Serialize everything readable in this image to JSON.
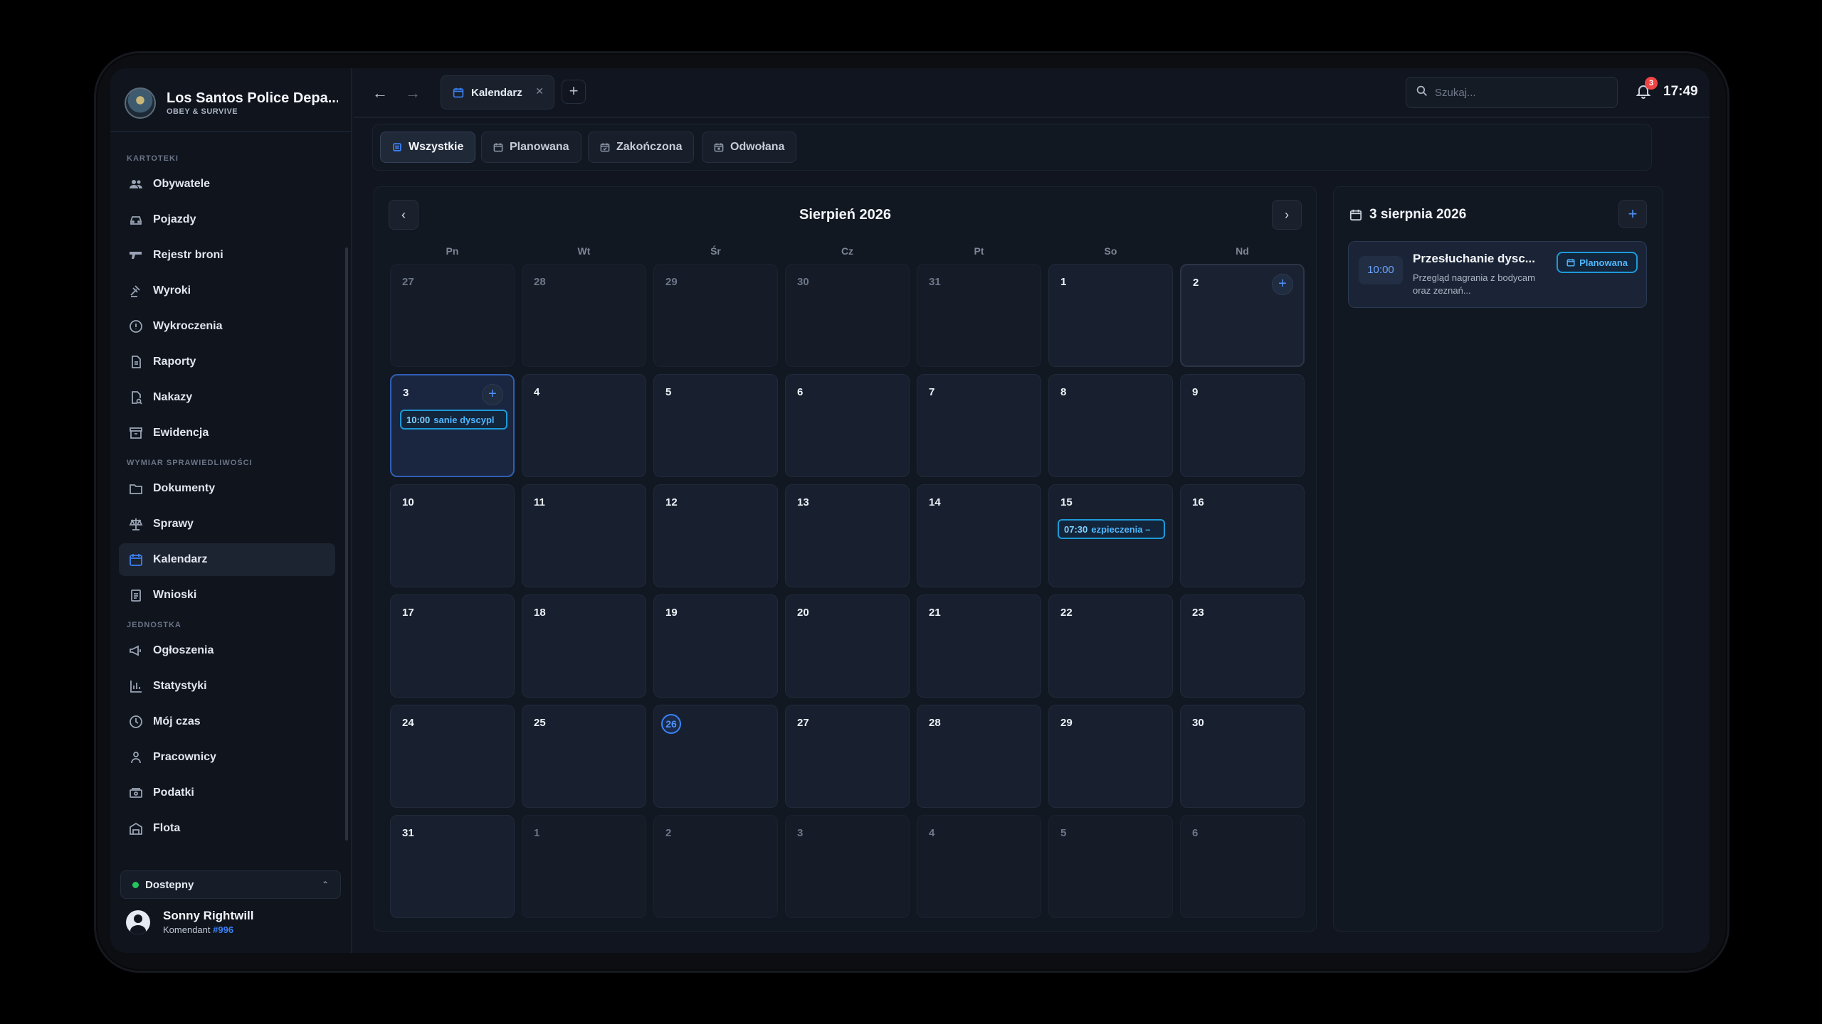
{
  "org": {
    "name": "Los Santos Police Depa...",
    "motto": "OBEY & SURVIVE"
  },
  "nav": {
    "sections": [
      {
        "title": "KARTOTEKI",
        "items": [
          "Obywatele",
          "Pojazdy",
          "Rejestr broni",
          "Wyroki",
          "Wykroczenia",
          "Raporty",
          "Nakazy",
          "Ewidencja"
        ]
      },
      {
        "title": "WYMIAR SPRAWIEDLIWOŚCI",
        "items": [
          "Dokumenty",
          "Sprawy",
          "Kalendarz",
          "Wnioski"
        ]
      },
      {
        "title": "JEDNOSTKA",
        "items": [
          "Ogłoszenia",
          "Statystyki",
          "Mój czas",
          "Pracownicy",
          "Podatki",
          "Flota"
        ]
      }
    ],
    "active": "Kalendarz"
  },
  "status": {
    "label": "Dostepny",
    "color": "#22c55e"
  },
  "user": {
    "name": "Sonny Rightwill",
    "rank": "Komendant",
    "badge": "#996"
  },
  "topbar": {
    "tab_label": "Kalendarz",
    "search_placeholder": "Szukaj...",
    "notifications": "3",
    "clock": "17:49"
  },
  "filters": [
    "Wszystkie",
    "Planowana",
    "Zakończona",
    "Odwołana"
  ],
  "calendar": {
    "title": "Sierpień 2026",
    "weekdays": [
      "Pn",
      "Wt",
      "Śr",
      "Cz",
      "Pt",
      "So",
      "Nd"
    ],
    "days": [
      "27",
      "28",
      "29",
      "30",
      "31",
      "1",
      "2",
      "3",
      "4",
      "5",
      "6",
      "7",
      "8",
      "9",
      "10",
      "11",
      "12",
      "13",
      "14",
      "15",
      "16",
      "17",
      "18",
      "19",
      "20",
      "21",
      "22",
      "23",
      "24",
      "25",
      "26",
      "27",
      "28",
      "29",
      "30",
      "31",
      "1",
      "2",
      "3",
      "4",
      "5",
      "6"
    ],
    "events": [
      {
        "time": "10:00",
        "label": "sanie dyscypl"
      },
      {
        "time": "07:30",
        "label": "ezpieczenia –"
      }
    ]
  },
  "side": {
    "date": "3 sierpnia 2026",
    "event": {
      "time": "10:00",
      "title": "Przesłuchanie dysc...",
      "desc": "Przegląd nagrania z bodycam oraz zeznań...",
      "status": "Planowana"
    }
  },
  "colors": {
    "accent": "#3b82f6",
    "event_border": "#1d9ad8",
    "danger": "#ef4444"
  }
}
